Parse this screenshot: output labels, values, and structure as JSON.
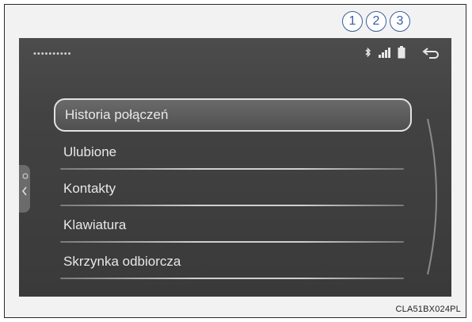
{
  "callouts": [
    "1",
    "2",
    "3"
  ],
  "status": {
    "device_name": "••••••••••",
    "icons": [
      "bluetooth-icon",
      "signal-strength-icon",
      "battery-icon",
      "back-arrow-icon"
    ]
  },
  "menu": {
    "items": [
      {
        "label": "Historia połączeń",
        "selected": true
      },
      {
        "label": "Ulubione",
        "selected": false
      },
      {
        "label": "Kontakty",
        "selected": false
      },
      {
        "label": "Klawiatura",
        "selected": false
      },
      {
        "label": "Skrzynka odbiorcza",
        "selected": false
      }
    ]
  },
  "figure_code": "CLA51BX024PL",
  "colors": {
    "screen_bg": "#424242",
    "callout": "#3b5f9a",
    "text": "#e8e8e8"
  }
}
